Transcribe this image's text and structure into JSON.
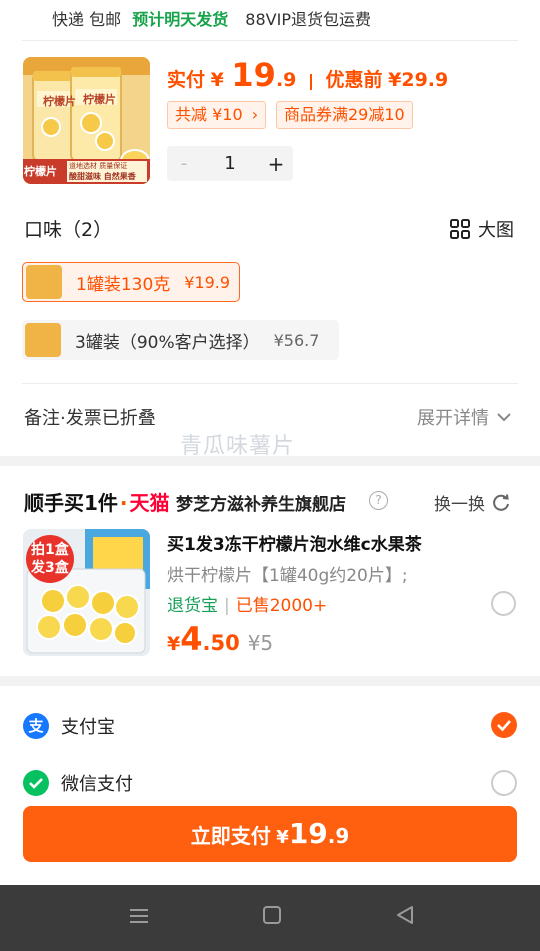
{
  "shipping": {
    "express": "快递 包邮",
    "delivery": "预计明天发货",
    "vip": "88VIP退货包运费"
  },
  "product": {
    "image_label": "柠檬片",
    "image_banner_red": "柠檬片",
    "image_banner_lines": [
      "道地选材 质量保证",
      "酸甜滋味 自然果香"
    ],
    "actual_label": "实付",
    "currency": "¥",
    "price_int": "19",
    "price_dec": ".9",
    "before_label": "优惠前",
    "before_price": "¥29.9",
    "discount_chip": "共减 ¥10",
    "coupon_chip": "商品券满29减10",
    "quantity": "1",
    "minus": "-",
    "plus": "+"
  },
  "flavor": {
    "title": "口味（2）",
    "big_view": "大图",
    "options": [
      {
        "name": "1罐装130克",
        "price": "¥19.9",
        "selected": true
      },
      {
        "name": "3罐装（90%客户选择）",
        "price": "¥56.7",
        "selected": false
      }
    ]
  },
  "remark": {
    "label": "备注·发票已折叠",
    "expand": "展开详情"
  },
  "watermark": "青瓜味薯片",
  "addon": {
    "brand": "顺手买1件",
    "dot": "·",
    "platform": "天猫",
    "shop": "梦芝方滋补养生旗舰店",
    "question": "?",
    "swap": "换一换",
    "badge_lines": [
      "拍1盒",
      "发3盒"
    ],
    "title": "买1发3冻干柠檬片泡水维c水果茶",
    "desc": "烘干柠檬片【1罐40g约20片】;",
    "tag_return": "退货宝",
    "tag_sep": "|",
    "tag_sold": "已售2000+",
    "currency": "¥",
    "price_int": "4",
    "price_dec": ".50",
    "orig_price": "¥5"
  },
  "payment": {
    "methods": [
      {
        "name": "支付宝",
        "icon_text": "支",
        "selected": true
      },
      {
        "name": "微信支付",
        "icon_text": "",
        "selected": false
      }
    ]
  },
  "pay_button": {
    "label": "立即支付",
    "currency": "¥",
    "amount_int": "19",
    "amount_dec": ".9"
  },
  "colors": {
    "accent": "#ff5000",
    "button": "#ff6010",
    "alipay": "#1677ff",
    "wechat": "#07c160",
    "green_text": "#17a34a",
    "nav_bg": "#3b3b3b"
  },
  "icons": {
    "grid": "grid-icon",
    "chevron": "chevron-down-icon",
    "refresh": "refresh-icon",
    "check": "check-icon",
    "nav": [
      "menu-icon",
      "home-square-icon",
      "back-triangle-icon"
    ]
  }
}
